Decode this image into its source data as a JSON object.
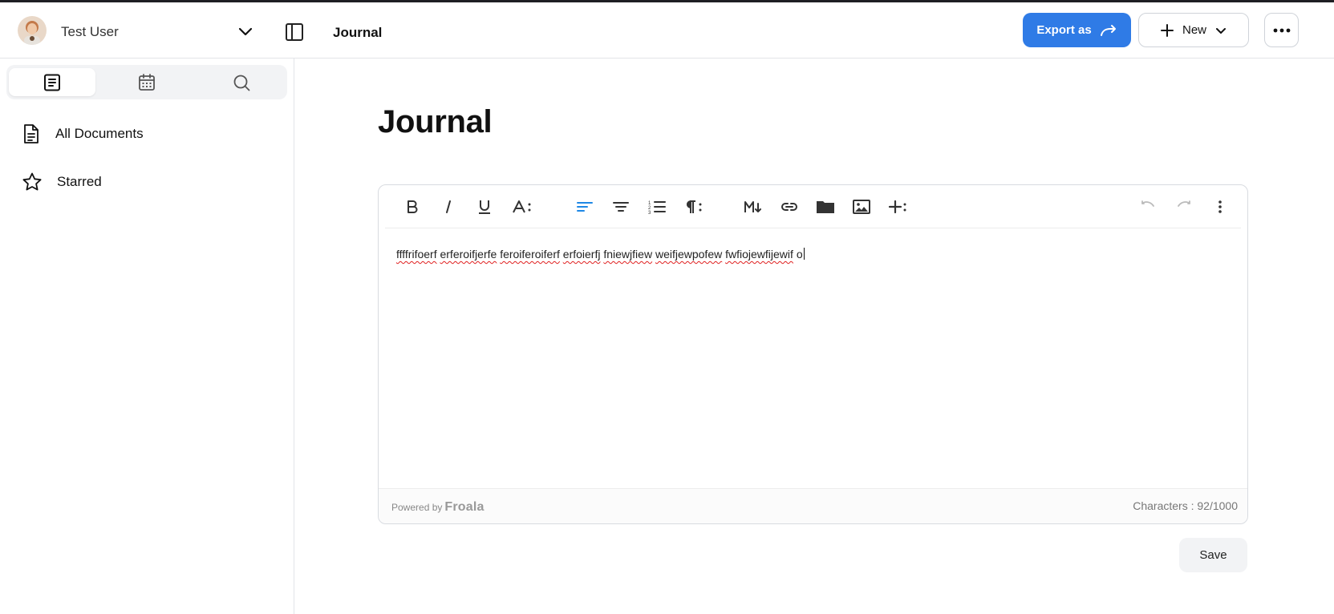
{
  "header": {
    "user_name": "Test User",
    "breadcrumb": "Journal",
    "export_label": "Export as",
    "new_label": "New",
    "accent_color": "#2f7be6"
  },
  "sidebar": {
    "view_tabs": [
      {
        "icon": "document-list-icon",
        "active": true
      },
      {
        "icon": "calendar-icon",
        "active": false
      },
      {
        "icon": "search-icon",
        "active": false
      }
    ],
    "items": [
      {
        "label": "All Documents",
        "icon": "document-icon"
      },
      {
        "label": "Starred",
        "icon": "star-icon"
      }
    ]
  },
  "main": {
    "title": "Journal",
    "editor": {
      "toolbar": [
        "bold-icon",
        "italic-icon",
        "underline-icon",
        "font-size-icon",
        "align-left-icon",
        "align-center-icon",
        "ordered-list-icon",
        "paragraph-format-icon",
        "markdown-icon",
        "link-icon",
        "folder-icon",
        "image-icon",
        "insert-more-icon",
        "undo-icon",
        "redo-icon",
        "more-vertical-icon"
      ],
      "words": [
        "ffffrifoerf",
        "erferoifjerfe",
        "feroiferoiferf",
        "erfoierfj",
        "fniewjfiew",
        "weifjewpofew",
        "fwfiojewfijewif",
        "o"
      ],
      "powered_by": "Powered by",
      "brand": "Froala",
      "char_count": "Characters : 92/1000"
    },
    "save_label": "Save"
  }
}
